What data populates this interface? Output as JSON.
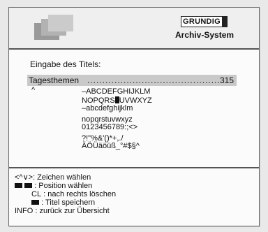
{
  "header": {
    "brand": "GRUNDIG",
    "system": "Archiv-System"
  },
  "entry": {
    "prompt": "Eingabe des Titels:",
    "title_value": "Tagesthemen",
    "leader": "............................................",
    "number": "315",
    "cursor": "^"
  },
  "charset": {
    "row1": "–ABCDEFGHIJKLM",
    "row2_before": "NOPQRS",
    "row2_after": "UVWXYZ",
    "row3": "–abcdefghijklm",
    "row4": "nopqrstuvwxyz",
    "row5": "0123456789:;<>",
    "row6": "?!\"%&'()*+,./",
    "row7": "ÄÖÜäöüß_°#$§^"
  },
  "help": {
    "l1_key": "<^∨>",
    "l1_text": ": Zeichen wählen",
    "l2_text": ": Position wählen",
    "l3_key": "CL",
    "l3_text": ": nach rechts löschen",
    "l4_text": ": Titel speichern",
    "l5_key": "INFO",
    "l5_text": ": zurück zur Übersicht"
  }
}
